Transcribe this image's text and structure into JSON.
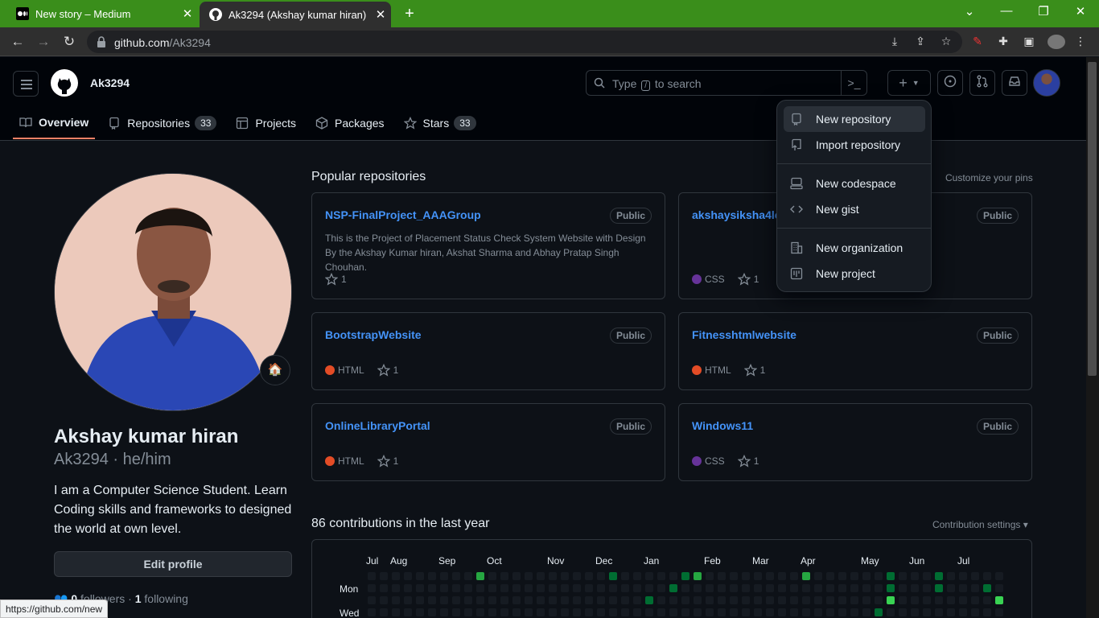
{
  "browser": {
    "tabs": [
      {
        "title": "New story – Medium"
      },
      {
        "title": "Ak3294 (Akshay kumar hiran)"
      }
    ],
    "url_domain": "github.com",
    "url_path": "/Ak3294",
    "status_url": "https://github.com/new"
  },
  "header": {
    "username": "Ak3294",
    "search_prefix": "Type",
    "search_key": "/",
    "search_suffix": "to search",
    "command_glyph": ">_"
  },
  "profile_tabs": [
    {
      "label": "Overview"
    },
    {
      "label": "Repositories",
      "count": "33"
    },
    {
      "label": "Projects"
    },
    {
      "label": "Packages"
    },
    {
      "label": "Stars",
      "count": "33"
    }
  ],
  "profile": {
    "name": "Akshay kumar hiran",
    "login_pronouns": "Ak3294 · he/him",
    "bio": "I am a Computer Science Student. Learn Coding skills and frameworks to designed the world at own level.",
    "edit_label": "Edit profile",
    "followers_count": "0",
    "followers_label": "followers",
    "following_count": "1",
    "following_label": "following"
  },
  "popular": {
    "title": "Popular repositories",
    "customize_label": "Customize your pins",
    "repos": [
      {
        "name": "NSP-FinalProject_AAAGroup",
        "visibility": "Public",
        "description": "This is the Project of Placement Status Check System Website with Design By the Akshay Kumar hiran, Akshat Sharma and Abhay Pratap Singh Chouhan.",
        "language": "",
        "lang_color": "",
        "stars": "1"
      },
      {
        "name": "akshaysiksha4lea",
        "visibility": "Public",
        "description": "",
        "language": "CSS",
        "lang_color": "#663399",
        "stars": "1"
      },
      {
        "name": "BootstrapWebsite",
        "visibility": "Public",
        "description": "",
        "language": "HTML",
        "lang_color": "#e34c26",
        "stars": "1"
      },
      {
        "name": "Fitnesshtmlwebsite",
        "visibility": "Public",
        "description": "",
        "language": "HTML",
        "lang_color": "#e34c26",
        "stars": "1"
      },
      {
        "name": "OnlineLibraryPortal",
        "visibility": "Public",
        "description": "",
        "language": "HTML",
        "lang_color": "#e34c26",
        "stars": "1"
      },
      {
        "name": "Windows11",
        "visibility": "Public",
        "description": "",
        "language": "CSS",
        "lang_color": "#663399",
        "stars": "1"
      }
    ]
  },
  "contributions": {
    "title": "86 contributions in the last year",
    "settings_label": "Contribution settings ▾",
    "months": [
      "Jul",
      "Aug",
      "Sep",
      "Oct",
      "Nov",
      "Dec",
      "Jan",
      "Feb",
      "Mar",
      "Apr",
      "May",
      "Jun",
      "Jul"
    ],
    "days": [
      "Mon",
      "Wed"
    ]
  },
  "create_menu": {
    "items": [
      {
        "label": "New repository"
      },
      {
        "label": "Import repository"
      },
      {
        "label": "New codespace"
      },
      {
        "label": "New gist"
      },
      {
        "label": "New organization"
      },
      {
        "label": "New project"
      }
    ]
  },
  "colors": {
    "accent_link": "#4493f8",
    "tab_underline": "#f78166",
    "browser_frame": "#3a8e1b"
  }
}
